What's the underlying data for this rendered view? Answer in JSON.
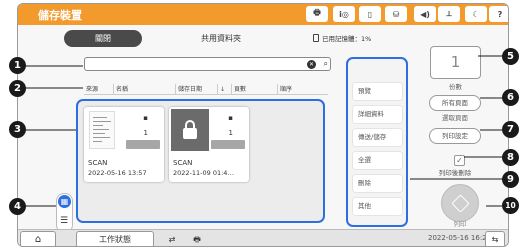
{
  "topbar": {
    "title": "儲存裝置",
    "icons": [
      {
        "name": "printer-status-icon",
        "glyph": "🖶"
      },
      {
        "name": "info-icon",
        "glyph": "i◎"
      },
      {
        "name": "paper-icon",
        "glyph": "▯"
      },
      {
        "name": "network-icon",
        "glyph": "⛁"
      },
      {
        "name": "volume-icon",
        "glyph": "◀)"
      },
      {
        "name": "wifi-off-icon",
        "glyph": "⟂"
      },
      {
        "name": "night-mode-icon",
        "glyph": "☾"
      },
      {
        "name": "help-icon",
        "glyph": "?"
      }
    ]
  },
  "main": {
    "close_tab": "關閉",
    "folder_title": "共用資料夾",
    "usage_label": "已用記憶體：1%",
    "search": {
      "value": "",
      "clear_glyph": "✕",
      "search_glyph": "⌕"
    },
    "columns": [
      "來源",
      "名稱",
      "儲存日期",
      "↓",
      "頁數",
      "順序"
    ],
    "files": [
      {
        "name": "SCAN",
        "date": "2022-05-16 13:57",
        "count": "1",
        "locked": false
      },
      {
        "name": "SCAN",
        "date": "2022-11-09 01:4…",
        "count": "1",
        "locked": true
      }
    ],
    "view_toggle": {
      "grid_glyph": "▦",
      "list_glyph": "☰"
    }
  },
  "side_menu": [
    "預覽",
    "詳細資料",
    "傳送/儲存",
    "全選",
    "刪除",
    "其他"
  ],
  "right_panel": {
    "copies": "1",
    "copies_label": "份數",
    "all_pages": "所有頁面",
    "select_pages": "選取頁面",
    "print_settings": "列印設定",
    "delete_check": "✓",
    "delete_after_print": "列印後刪除",
    "print_label": "列印"
  },
  "bottombar": {
    "home_glyph": "⌂",
    "job_status": "工作狀態",
    "icon1_glyph": "⇄",
    "icon2_glyph": "🖶",
    "datetime": "2022-05-16 16:20",
    "net_glyph": "⇆"
  },
  "callouts": [
    "1",
    "2",
    "3",
    "4",
    "5",
    "6",
    "7",
    "8",
    "9",
    "10"
  ]
}
